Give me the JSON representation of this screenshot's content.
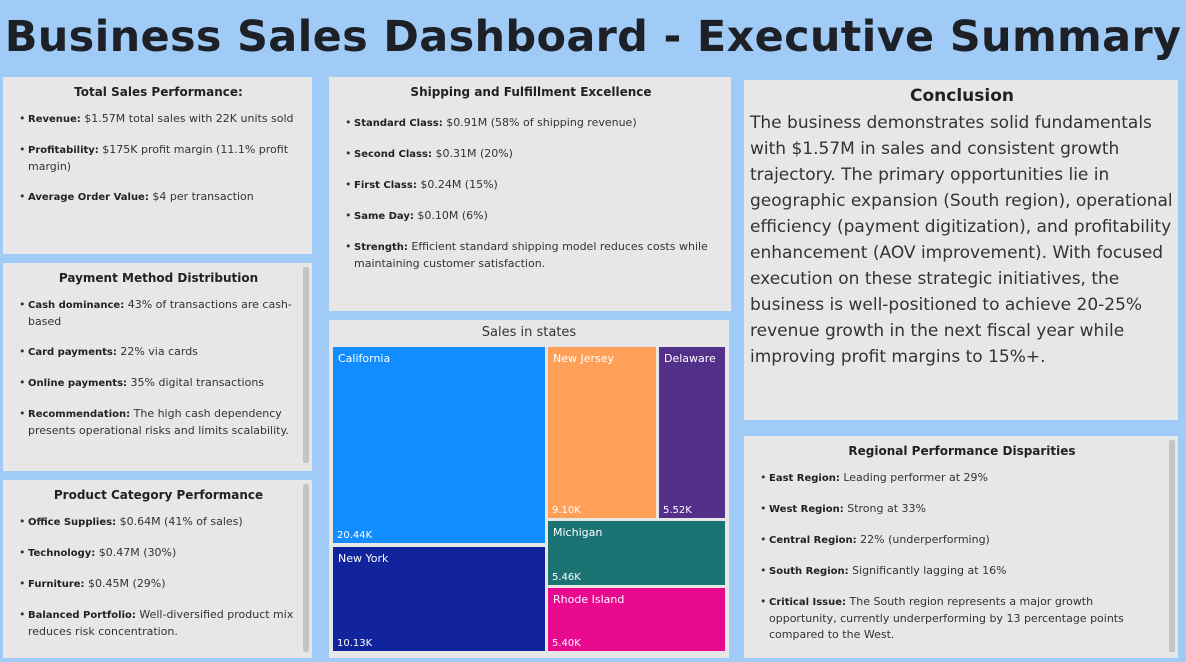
{
  "title": "Business Sales Dashboard - Executive Summary",
  "total_sales": {
    "heading": "Total Sales Performance:",
    "items": [
      {
        "label": "Revenue:",
        "text": " $1.57M total sales with 22K units sold"
      },
      {
        "label": "Profitability:",
        "text": " $175K profit margin (11.1% profit margin)"
      },
      {
        "label": "Average Order Value:",
        "text": " $4 per transaction"
      }
    ]
  },
  "payment": {
    "heading": "Payment Method Distribution",
    "items": [
      {
        "label": "Cash dominance:",
        "text": " 43% of transactions are cash-based"
      },
      {
        "label": "Card payments:",
        "text": " 22% via cards"
      },
      {
        "label": "Online payments:",
        "text": " 35% digital transactions"
      },
      {
        "label": "Recommendation:",
        "text": " The high cash dependency presents operational risks and limits scalability."
      }
    ]
  },
  "product": {
    "heading": "Product Category Performance",
    "items": [
      {
        "label": "Office Supplies:",
        "text": " $0.64M (41% of sales)"
      },
      {
        "label": "Technology:",
        "text": " $0.47M (30%)"
      },
      {
        "label": "Furniture:",
        "text": " $0.45M (29%)"
      },
      {
        "label": "Balanced Portfolio:",
        "text": " Well-diversified product mix reduces risk concentration."
      }
    ]
  },
  "shipping": {
    "heading": "Shipping and Fulfillment Excellence",
    "items": [
      {
        "label": "Standard Class:",
        "text": " $0.91M (58% of shipping revenue)"
      },
      {
        "label": "Second Class:",
        "text": " $0.31M (20%)"
      },
      {
        "label": "First Class:",
        "text": " $0.24M (15%)"
      },
      {
        "label": "Same Day:",
        "text": " $0.10M (6%)"
      },
      {
        "label": "Strength:",
        "text": " Efficient standard shipping model reduces costs while maintaining customer satisfaction."
      }
    ]
  },
  "conclusion": {
    "heading": "Conclusion",
    "body": "The business demonstrates solid fundamentals with $1.57M in sales and consistent growth trajectory. The primary opportunities lie in geographic expansion (South region), operational efficiency (payment digitization), and profitability enhancement (AOV improvement). With focused execution on these strategic initiatives, the business is well-positioned to achieve 20-25% revenue growth in the next fiscal year while improving profit margins to 15%+."
  },
  "regional": {
    "heading": "Regional Performance Disparities",
    "items": [
      {
        "label": "East Region:",
        "text": " Leading performer at 29%"
      },
      {
        "label": "West Region:",
        "text": " Strong at 33%"
      },
      {
        "label": "Central Region:",
        "text": " 22% (underperforming)"
      },
      {
        "label": "South Region:",
        "text": " Significantly lagging at 16%"
      },
      {
        "label": "Critical Issue:",
        "text": " The South region represents a major growth opportunity, currently underperforming by 13 percentage points compared to the West."
      }
    ]
  },
  "chart_data": {
    "type": "treemap",
    "title": "Sales in states",
    "tiles": [
      {
        "name": "California",
        "value_label": "20.44K",
        "value": 20440,
        "color": "#118dff"
      },
      {
        "name": "New York",
        "value_label": "10.13K",
        "value": 10130,
        "color": "#12239e"
      },
      {
        "name": "New Jersey",
        "value_label": "9.10K",
        "value": 9100,
        "color": "#ff9f58"
      },
      {
        "name": "Delaware",
        "value_label": "5.52K",
        "value": 5520,
        "color": "#53308a"
      },
      {
        "name": "Michigan",
        "value_label": "5.46K",
        "value": 5460,
        "color": "#1b7373"
      },
      {
        "name": "Rhode Island",
        "value_label": "5.40K",
        "value": 5400,
        "color": "#e8098f"
      }
    ]
  }
}
